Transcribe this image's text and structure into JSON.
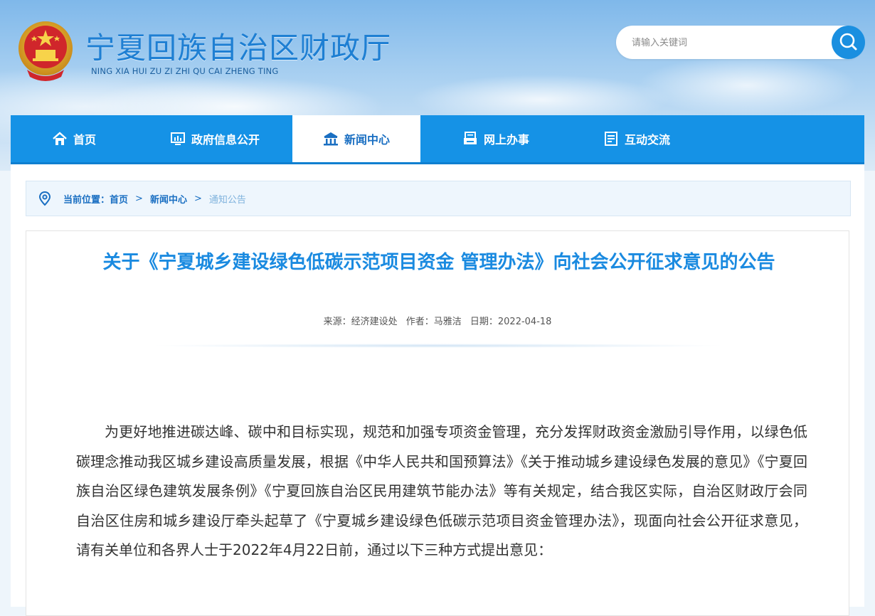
{
  "header": {
    "title": "宁夏回族自治区财政厅",
    "subtitle": "NING XIA HUI ZU ZI ZHI QU CAI ZHENG TING",
    "search_placeholder": "请输入关键词"
  },
  "nav": {
    "items": [
      {
        "label": "首页",
        "icon": "home-icon"
      },
      {
        "label": "政府信息公开",
        "icon": "monitor-chart-icon"
      },
      {
        "label": "新闻中心",
        "icon": "institution-icon",
        "active": true
      },
      {
        "label": "网上办事",
        "icon": "form-printer-icon"
      },
      {
        "label": "互动交流",
        "icon": "document-list-icon"
      }
    ]
  },
  "breadcrumb": {
    "label": "当前位置：",
    "items": [
      "首页",
      "新闻中心",
      "通知公告"
    ],
    "separator": ">"
  },
  "article": {
    "title": "关于《宁夏城乡建设绿色低碳示范项目资金 管理办法》向社会公开征求意见的公告",
    "source": "来源：经济建设处",
    "author": "作者：马雅洁",
    "date": "日期：2022-04-18",
    "body": "为更好地推进碳达峰、碳中和目标实现，规范和加强专项资金管理，充分发挥财政资金激励引导作用，以绿色低碳理念推动我区城乡建设高质量发展，根据《中华人民共和国预算法》《关于推动城乡建设绿色发展的意见》《宁夏回族自治区绿色建筑发展条例》《宁夏回族自治区民用建筑节能办法》等有关规定，结合我区实际，自治区财政厅会同自治区住房和城乡建设厅牵头起草了《宁夏城乡建设绿色低碳示范项目资金管理办法》，现面向社会公开征求意见，请有关单位和各界人士于2022年4月22日前，通过以下三种方式提出意见："
  },
  "colors": {
    "brand_blue": "#1592e6",
    "title_blue": "#1a8ae0",
    "nav_active_text": "#1a6fc2"
  }
}
